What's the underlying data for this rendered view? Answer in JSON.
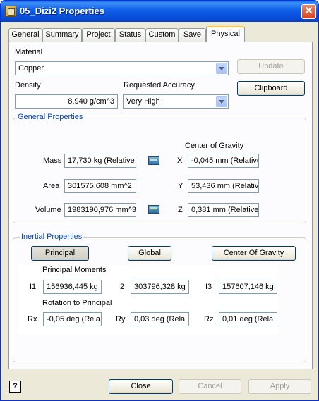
{
  "window": {
    "title": "05_Dizi2 Properties",
    "close_glyph": "✕"
  },
  "tabs": [
    "General",
    "Summary",
    "Project",
    "Status",
    "Custom",
    "Save",
    "Physical"
  ],
  "active_tab": "Physical",
  "material": {
    "label": "Material",
    "value": "Copper"
  },
  "density": {
    "label": "Density",
    "value": "8,940 g/cm^3"
  },
  "accuracy": {
    "label": "Requested Accuracy",
    "value": "Very High"
  },
  "buttons": {
    "update": "Update",
    "clipboard": "Clipboard"
  },
  "general_props": {
    "title": "General Properties",
    "mass_label": "Mass",
    "mass_value": "17,730 kg (Relative",
    "area_label": "Area",
    "area_value": "301575,608 mm^2",
    "volume_label": "Volume",
    "volume_value": "1983190,976 mm^3",
    "cog_title": "Center of Gravity",
    "x_label": "X",
    "x_value": "-0,045 mm (Relative",
    "y_label": "Y",
    "y_value": "53,436 mm (Relative",
    "z_label": "Z",
    "z_value": "0,381 mm (Relative"
  },
  "inertial": {
    "title": "Inertial Properties",
    "btn_principal": "Principal",
    "btn_global": "Global",
    "btn_cog": "Center Of Gravity",
    "moments_title": "Principal Moments",
    "i1_label": "I1",
    "i1_value": "156936,445 kg",
    "i2_label": "I2",
    "i2_value": "303796,328 kg",
    "i3_label": "I3",
    "i3_value": "157607,146 kg",
    "rotation_title": "Rotation to Principal",
    "rx_label": "Rx",
    "rx_value": "-0,05 deg (Rela",
    "ry_label": "Ry",
    "ry_value": "0,03 deg (Rela",
    "rz_label": "Rz",
    "rz_value": "0,01 deg (Rela"
  },
  "footer": {
    "help": "?",
    "close": "Close",
    "cancel": "Cancel",
    "apply": "Apply"
  },
  "colors": {
    "title_bar": "#0a5fe3",
    "group_title": "#0046d5",
    "face": "#ece9d8"
  }
}
